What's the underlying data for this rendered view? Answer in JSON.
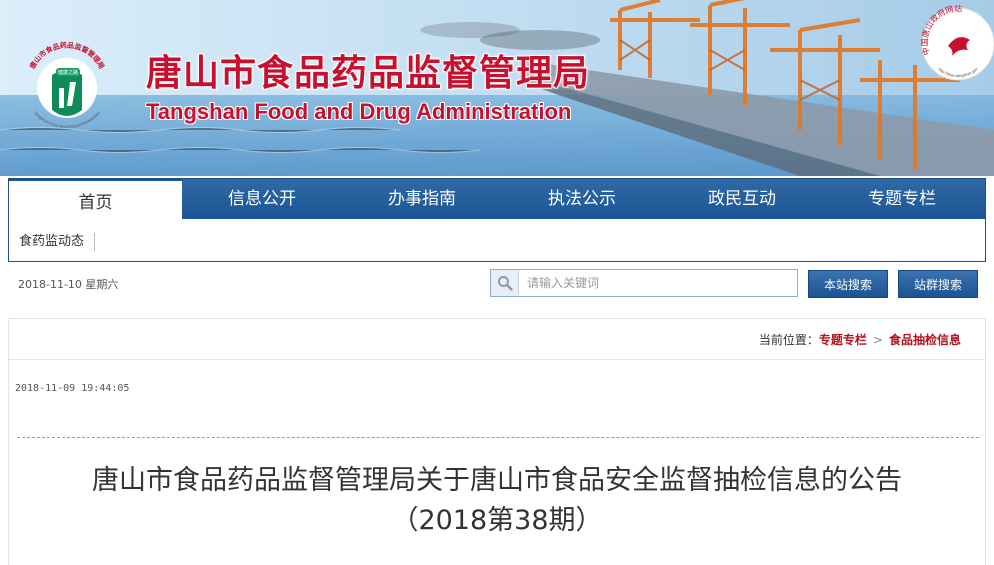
{
  "header": {
    "title_cn": "唐山市食品药品监督管理局",
    "title_en": "Tangshan Food and Drug Administration",
    "logo": {
      "icon": "logo-icon",
      "ring_text": "唐山市食品药品监督管理局",
      "bottom_text": "Tangshan Food and Drug Administration",
      "tag": "健康之路"
    },
    "seal": {
      "icon": "gov-seal-icon",
      "text": "中国唐山政府网站",
      "url_text": "http://www.tangshan.gov"
    }
  },
  "nav": {
    "items": [
      {
        "label": "首页",
        "active": true
      },
      {
        "label": "信息公开"
      },
      {
        "label": "办事指南"
      },
      {
        "label": "执法公示"
      },
      {
        "label": "政民互动"
      },
      {
        "label": "专题专栏"
      }
    ],
    "sub_items": [
      "食药监动态"
    ]
  },
  "toolbar": {
    "date": "2018-11-10 星期六",
    "search_placeholder": "请输入关键词",
    "search_icon": "search-icon",
    "site_search_label": "本站搜索",
    "group_search_label": "站群搜索"
  },
  "content": {
    "breadcrumb": {
      "prefix": "当前位置：",
      "items": [
        "专题专栏",
        "食品抽检信息"
      ],
      "separator_icon": "chevron-right-icon"
    },
    "publish_time": "2018-11-09 19:44:05",
    "title_line1": "唐山市食品药品监督管理局关于唐山市食品安全监督抽检信息的公告",
    "title_line2": "（2018第38期）"
  },
  "colors": {
    "brand_red": "#c8102e",
    "nav_blue": "#1b5595",
    "breadcrumb_red": "#b3121f"
  }
}
